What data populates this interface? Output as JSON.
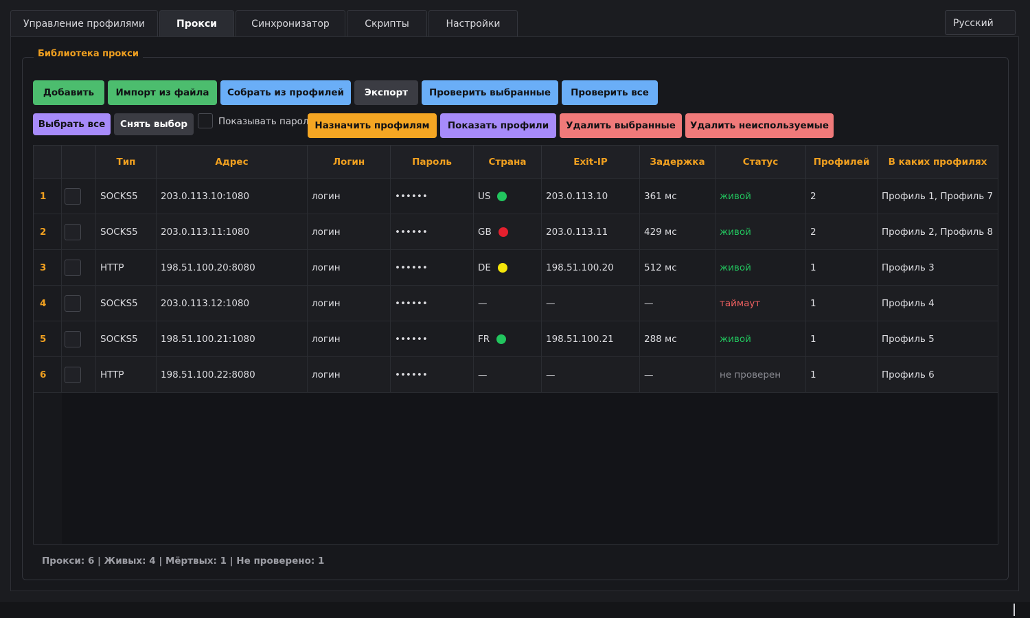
{
  "tabs": [
    {
      "label": "Управление профилями"
    },
    {
      "label": "Прокси"
    },
    {
      "label": "Синхронизатор"
    },
    {
      "label": "Скрипты"
    },
    {
      "label": "Настройки"
    }
  ],
  "language": "Русский",
  "group_title": "Библиотека прокси",
  "toolbar": {
    "add": "Добавить",
    "import": "Импорт из файла",
    "collect": "Собрать из профилей",
    "export": "Экспорт",
    "check_selected": "Проверить выбранные",
    "check_all": "Проверить все",
    "select_all": "Выбрать все",
    "deselect": "Снять выбор",
    "show_passwords": "Показывать пароли",
    "assign": "Назначить профилям",
    "show_profiles": "Показать профили",
    "delete_selected": "Удалить выбранные",
    "delete_unused": "Удалить неиспользуемые"
  },
  "colors": {
    "green": "#4cbd6e",
    "blue": "#6aaef7",
    "gray": "#3b3c43",
    "purple": "#a78bfa",
    "orange": "#f5a623",
    "red": "#f07a7a",
    "accent": "#f0a020",
    "alive": "#22c55e",
    "dot_green": "#22c55e",
    "dot_red": "#e5202e",
    "dot_yellow": "#f5e50a"
  },
  "table": {
    "headers": [
      "Тип",
      "Адрес",
      "Логин",
      "Пароль",
      "Страна",
      "Exit-IP",
      "Задержка",
      "Статус",
      "Профилей",
      "В каких профилях"
    ],
    "rows": [
      {
        "n": "1",
        "type": "SOCKS5",
        "addr": "203.0.113.10:1080",
        "login": "логин",
        "pass": "••••••",
        "country": "US",
        "dot": "green",
        "exit": "203.0.113.10",
        "delay": "361 мс",
        "status": "живой",
        "status_kind": "alive",
        "count": "2",
        "profiles": "Профиль 1, Профиль 7"
      },
      {
        "n": "2",
        "type": "SOCKS5",
        "addr": "203.0.113.11:1080",
        "login": "логин",
        "pass": "••••••",
        "country": "GB",
        "dot": "red",
        "exit": "203.0.113.11",
        "delay": "429 мс",
        "status": "живой",
        "status_kind": "alive",
        "count": "2",
        "profiles": "Профиль 2, Профиль 8"
      },
      {
        "n": "3",
        "type": "HTTP",
        "addr": "198.51.100.20:8080",
        "login": "логин",
        "pass": "••••••",
        "country": "DE",
        "dot": "yellow",
        "exit": "198.51.100.20",
        "delay": "512 мс",
        "status": "живой",
        "status_kind": "alive",
        "count": "1",
        "profiles": "Профиль 3"
      },
      {
        "n": "4",
        "type": "SOCKS5",
        "addr": "203.0.113.12:1080",
        "login": "логин",
        "pass": "••••••",
        "country": "—",
        "dot": "",
        "exit": "—",
        "delay": "—",
        "status": "таймаут",
        "status_kind": "timeout",
        "count": "1",
        "profiles": "Профиль 4"
      },
      {
        "n": "5",
        "type": "SOCKS5",
        "addr": "198.51.100.21:1080",
        "login": "логин",
        "pass": "••••••",
        "country": "FR",
        "dot": "green",
        "exit": "198.51.100.21",
        "delay": "288 мс",
        "status": "живой",
        "status_kind": "alive",
        "count": "1",
        "profiles": "Профиль 5"
      },
      {
        "n": "6",
        "type": "HTTP",
        "addr": "198.51.100.22:8080",
        "login": "логин",
        "pass": "••••••",
        "country": "—",
        "dot": "",
        "exit": "—",
        "delay": "—",
        "status": "не проверен",
        "status_kind": "unchecked",
        "count": "1",
        "profiles": "Профиль 6"
      }
    ]
  },
  "status_bar": "Прокси: 6 | Живых: 4 | Мёртвых: 1 | Не проверено: 1"
}
